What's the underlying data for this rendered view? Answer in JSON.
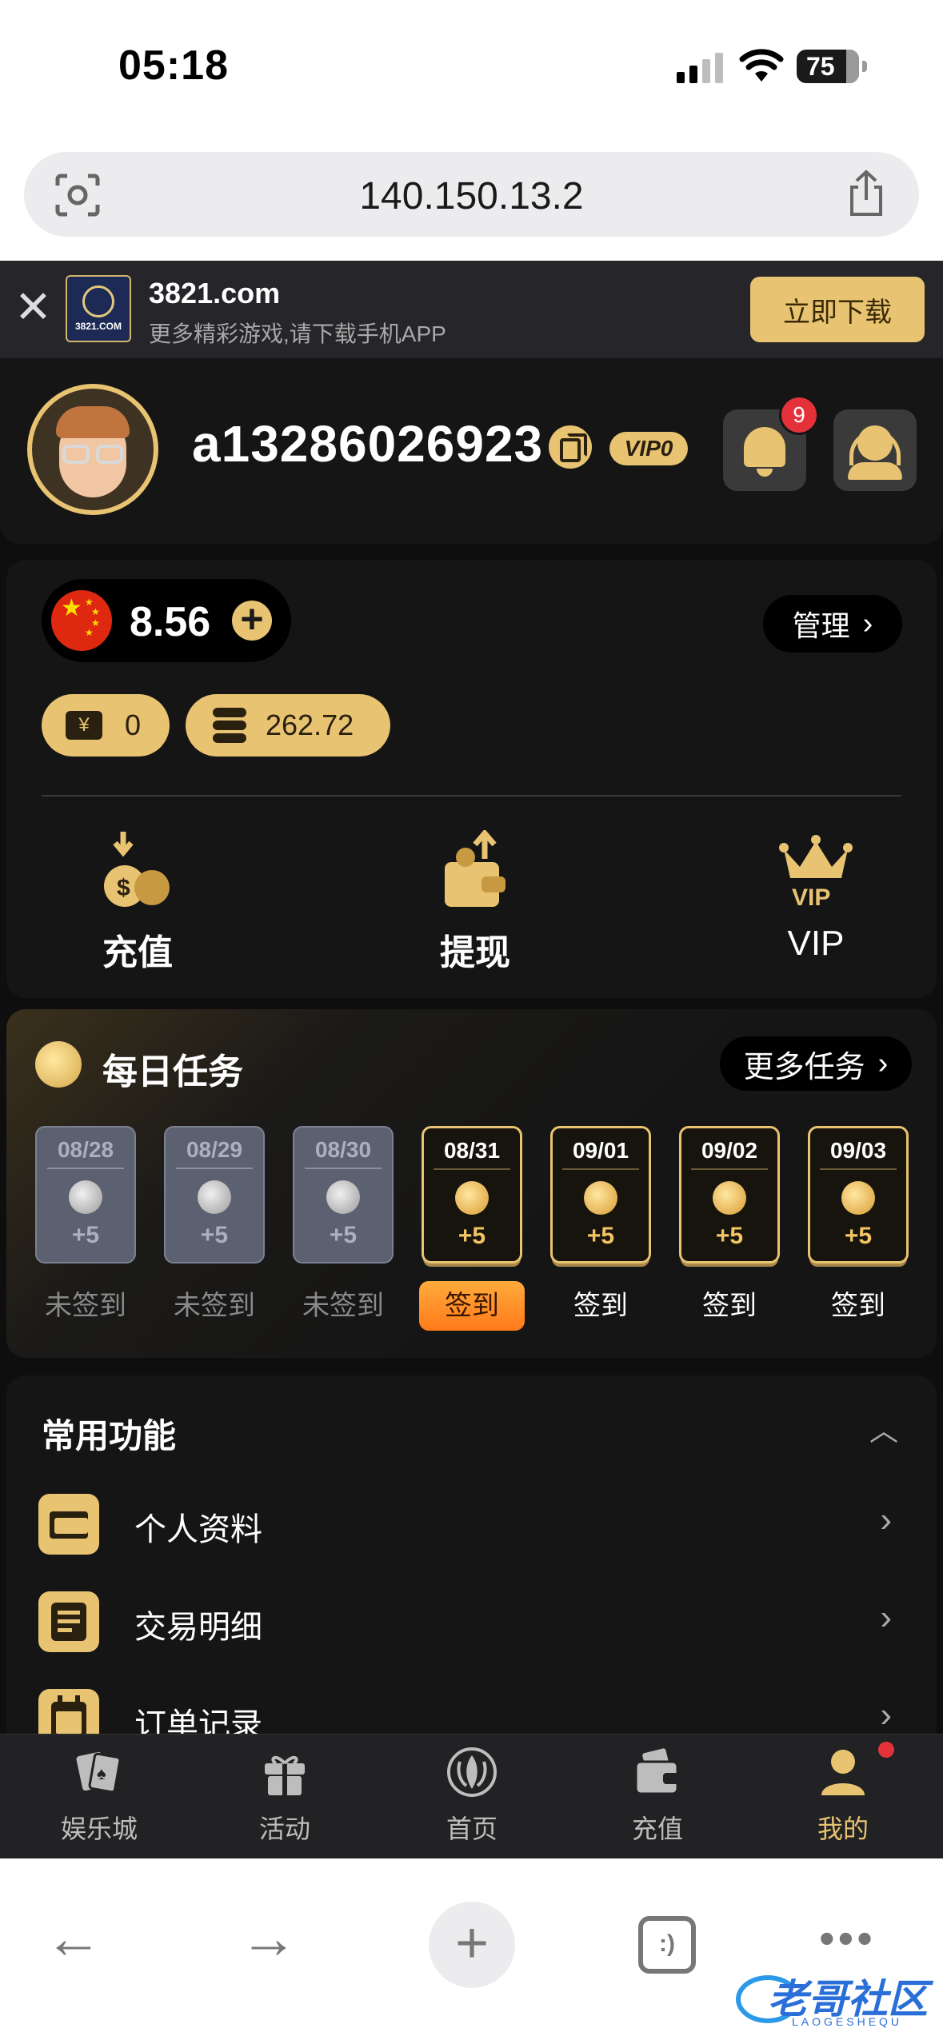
{
  "status_bar": {
    "time": "05:18",
    "battery": "75"
  },
  "browser": {
    "url": "140.150.13.2"
  },
  "banner": {
    "site": "3821.com",
    "subtitle": "更多精彩游戏,请下载手机APP",
    "download_label": "立即下载",
    "logo_text": "3821.COM"
  },
  "profile": {
    "username": "a13286026923",
    "vip_level": "VIP0",
    "notification_count": "9"
  },
  "wallet": {
    "currency": "CNY",
    "balance": "8.56",
    "manage_label": "管理",
    "tickets": "0",
    "coins": "262.72",
    "actions": [
      {
        "label": "充值",
        "icon": "deposit-money-bags-icon"
      },
      {
        "label": "提现",
        "icon": "withdraw-wallet-icon"
      },
      {
        "label": "VIP",
        "icon": "vip-crown-icon"
      }
    ]
  },
  "daily_tasks": {
    "title": "每日任务",
    "more_label": "更多任务",
    "days": [
      {
        "date": "08/28",
        "points": "+5",
        "status": "未签到",
        "state": "past"
      },
      {
        "date": "08/29",
        "points": "+5",
        "status": "未签到",
        "state": "past"
      },
      {
        "date": "08/30",
        "points": "+5",
        "status": "未签到",
        "state": "past"
      },
      {
        "date": "08/31",
        "points": "+5",
        "status": "签到",
        "state": "today"
      },
      {
        "date": "09/01",
        "points": "+5",
        "status": "签到",
        "state": "future"
      },
      {
        "date": "09/02",
        "points": "+5",
        "status": "签到",
        "state": "future"
      },
      {
        "date": "09/03",
        "points": "+5",
        "status": "签到",
        "state": "future"
      }
    ]
  },
  "common_functions": {
    "title": "常用功能",
    "items": [
      {
        "label": "个人资料",
        "icon": "folder-icon"
      },
      {
        "label": "交易明细",
        "icon": "document-list-icon"
      },
      {
        "label": "订单记录",
        "icon": "calendar-edit-icon"
      }
    ]
  },
  "tabbar": {
    "tabs": [
      {
        "label": "娱乐城",
        "icon": "cards-icon"
      },
      {
        "label": "活动",
        "icon": "gift-icon"
      },
      {
        "label": "首页",
        "icon": "home-logo-icon"
      },
      {
        "label": "充值",
        "icon": "wallet-icon"
      },
      {
        "label": "我的",
        "icon": "user-icon",
        "active": true
      }
    ]
  },
  "toolbar": {
    "tabs_label": ":)"
  },
  "watermark": {
    "text": "老哥社区",
    "sub": "LAOGESHEQU"
  },
  "colors": {
    "gold": "#e8c371",
    "orange": "#ff8a24",
    "badge_red": "#e5323a",
    "background": "#0e0e0e",
    "card": "#151515"
  }
}
